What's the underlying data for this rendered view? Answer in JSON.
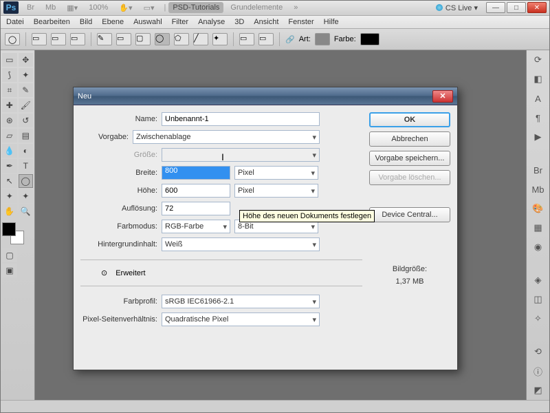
{
  "titlebar": {
    "logo": "Ps",
    "br": "Br",
    "mb": "Mb",
    "zoom": "100%",
    "tabs": [
      "PSD-Tutorials",
      "Grundelemente"
    ],
    "more": "»",
    "cslive": "CS Live ▾"
  },
  "menu": [
    "Datei",
    "Bearbeiten",
    "Bild",
    "Ebene",
    "Auswahl",
    "Filter",
    "Analyse",
    "3D",
    "Ansicht",
    "Fenster",
    "Hilfe"
  ],
  "optbar": {
    "art": "Art:",
    "farbe": "Farbe:"
  },
  "dialog": {
    "title": "Neu",
    "name_label": "Name:",
    "name": "Unbenannt-1",
    "preset_label": "Vorgabe:",
    "preset": "Zwischenablage",
    "size_label": "Größe:",
    "size": "",
    "width_label": "Breite:",
    "width": "800",
    "width_unit": "Pixel",
    "height_label": "Höhe:",
    "height": "600",
    "height_unit": "Pixel",
    "res_label": "Auflösung:",
    "res": "72",
    "mode_label": "Farbmodus:",
    "mode": "RGB-Farbe",
    "depth": "8-Bit",
    "bg_label": "Hintergrundinhalt:",
    "bg": "Weiß",
    "adv": "Erweitert",
    "profile_label": "Farbprofil:",
    "profile": "sRGB IEC61966-2.1",
    "par_label": "Pixel-Seitenverhältnis:",
    "par": "Quadratische Pixel",
    "ok": "OK",
    "cancel": "Abbrechen",
    "save": "Vorgabe speichern...",
    "delete": "Vorgabe löschen...",
    "device": "Device Central...",
    "filesize_label": "Bildgröße:",
    "filesize": "1,37 MB",
    "tooltip": "Höhe des neuen Dokuments festlegen"
  }
}
